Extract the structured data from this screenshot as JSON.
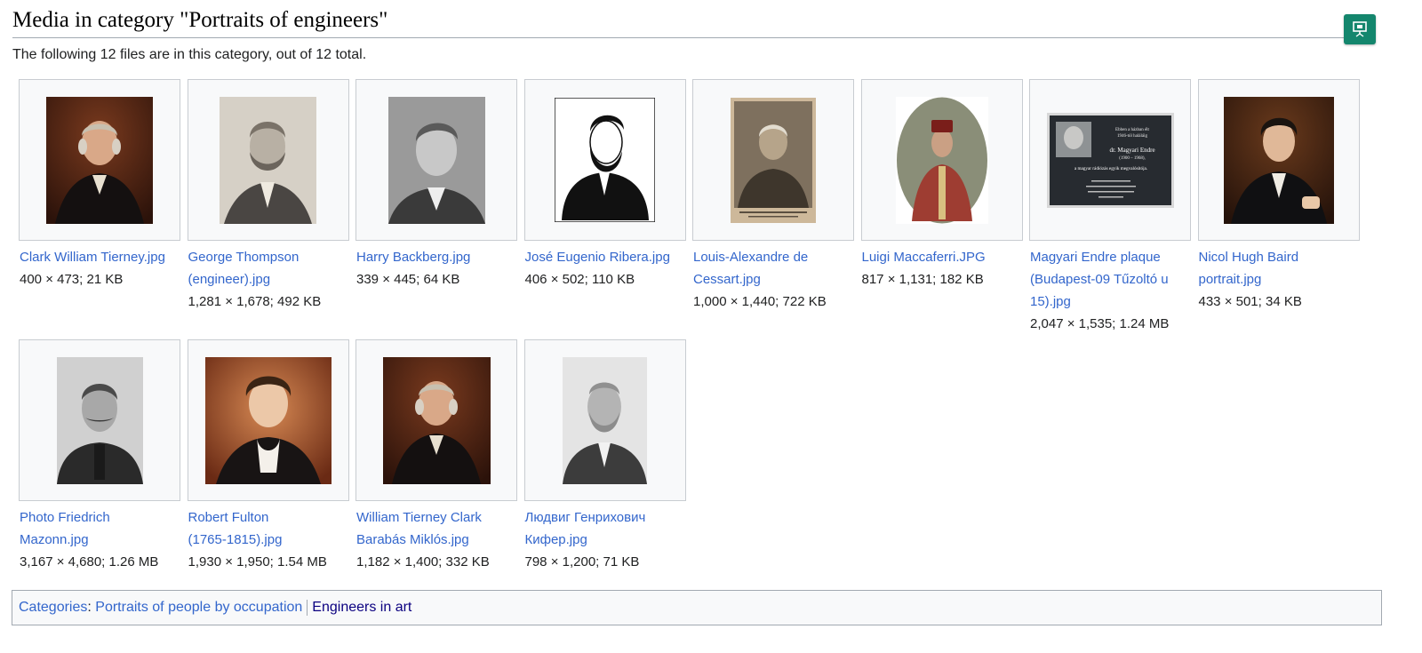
{
  "page": {
    "title": "Media in category \"Portraits of engineers\"",
    "intro": "The following 12 files are in this category, out of 12 total."
  },
  "toolbar": {
    "slideshow_icon": "presentation-screen-icon",
    "accent": "#14866d"
  },
  "gallery": {
    "row1": [
      {
        "name_lines": [
          "Clark William Tierney.jpg"
        ],
        "meta": "400 × 473; 21 KB"
      },
      {
        "name_lines": [
          "George Thompson",
          "(engineer).jpg"
        ],
        "meta": "1,281 × 1,678; 492 KB"
      },
      {
        "name_lines": [
          "Harry Backberg.jpg"
        ],
        "meta": "339 × 445; 64 KB"
      },
      {
        "name_lines": [
          "José Eugenio Ribera.jpg"
        ],
        "meta": "406 × 502; 110 KB"
      },
      {
        "name_lines": [
          "Louis-Alexandre de",
          "Cessart.jpg"
        ],
        "meta": "1,000 × 1,440; 722 KB"
      },
      {
        "name_lines": [
          "Luigi Maccaferri.JPG"
        ],
        "meta": "817 × 1,131; 182 KB"
      },
      {
        "name_lines": [
          "Magyari Endre plaque",
          "(Budapest-09 Tűzoltó u",
          "15).jpg"
        ],
        "meta": "2,047 × 1,535; 1.24 MB"
      },
      {
        "name_lines": [
          "Nicol Hugh Baird",
          "portrait.jpg"
        ],
        "meta": "433 × 501; 34 KB"
      }
    ],
    "row2": [
      {
        "name_lines": [
          "Photo Friedrich",
          "Mazonn.jpg"
        ],
        "meta": "3,167 × 4,680; 1.26 MB"
      },
      {
        "name_lines": [
          "Robert Fulton",
          "(1765-1815).jpg"
        ],
        "meta": "1,930 × 1,950; 1.54 MB"
      },
      {
        "name_lines": [
          "William Tierney Clark",
          "Barabás Miklós.jpg"
        ],
        "meta": "1,182 × 1,400; 332 KB"
      },
      {
        "name_lines": [
          "Людвиг Генрихович",
          "Кифер.jpg"
        ],
        "meta": "798 × 1,200; 71 KB"
      }
    ]
  },
  "plaque": {
    "line1": "Ebben a házban élt",
    "line2": "1946-tól haláláig",
    "name": "dr. Magyari Endre",
    "years": "(1900 – 1968),",
    "role": "a magyar rádiózás egyik megvalósítója."
  },
  "categories": {
    "label": "Categories",
    "items": [
      "Portraits of people by occupation",
      "Engineers in art"
    ]
  }
}
